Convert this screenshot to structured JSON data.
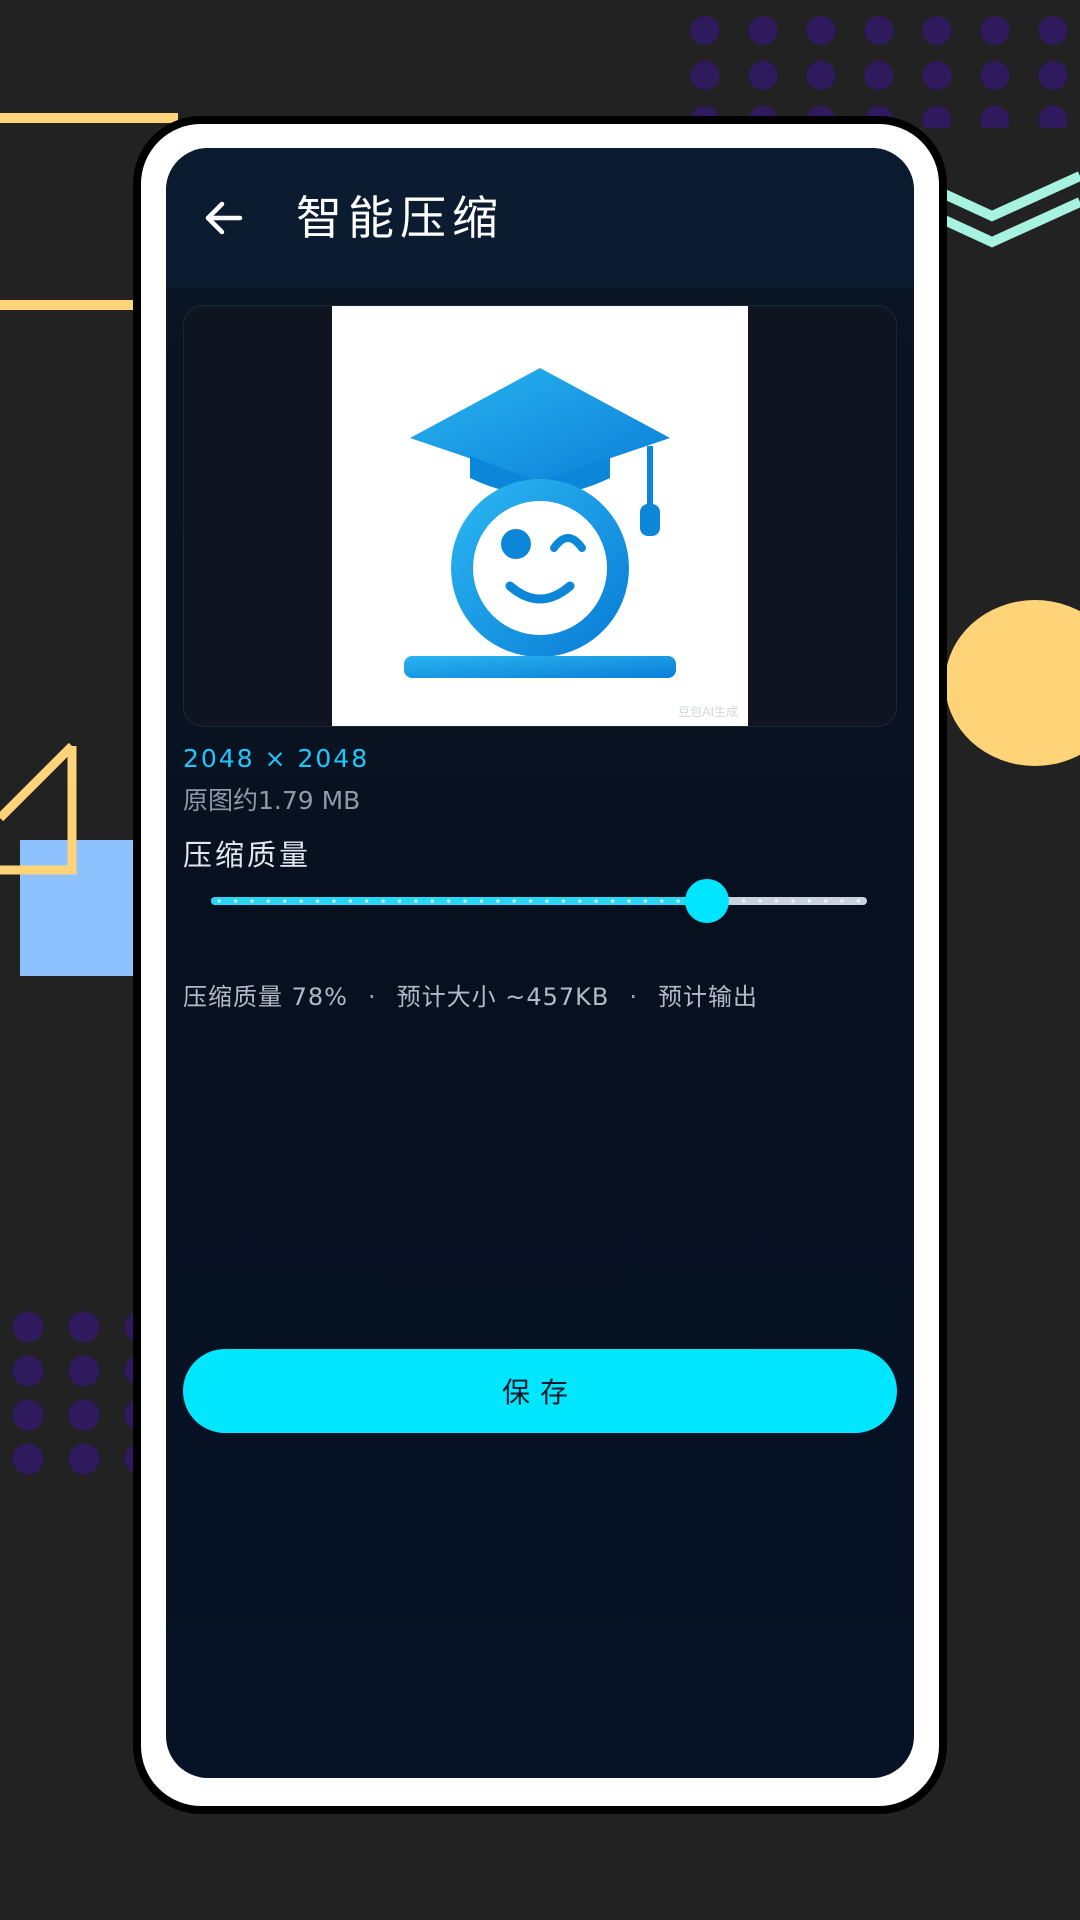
{
  "appbar": {
    "title": "智能压缩",
    "back_icon": "arrow-left-icon"
  },
  "preview": {
    "watermark": "豆包AI生成"
  },
  "image_info": {
    "width": "2048",
    "times": "×",
    "height": "2048",
    "original_size": "原图约1.79 MB"
  },
  "quality": {
    "label": "压缩质量",
    "value_percent": 78
  },
  "summary": {
    "quality_text": "压缩质量 78%",
    "separator": "·",
    "estimated_size": "预计大小 ~457KB",
    "estimated_output": "预计输出"
  },
  "actions": {
    "save_label": "保存"
  },
  "colors": {
    "accent": "#00e6fe",
    "dimension_text": "#1fc7ff",
    "background": "#222222",
    "screen": "#07101f"
  }
}
